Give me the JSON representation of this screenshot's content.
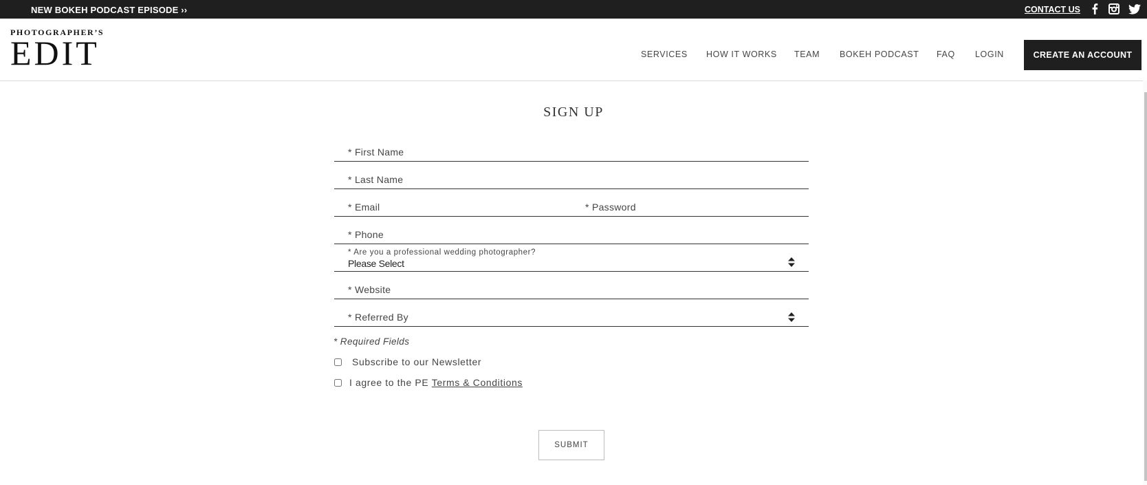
{
  "topbar": {
    "promo": "NEW BOKEH PODCAST EPISODE ››",
    "contact": "CONTACT US",
    "social": [
      {
        "name": "facebook-icon",
        "glyph": "f"
      },
      {
        "name": "instagram-icon",
        "glyph": "instagram"
      },
      {
        "name": "twitter-icon",
        "glyph": "twitter"
      }
    ]
  },
  "header": {
    "logo_top": "PHOTOGRAPHER’S",
    "logo_main": "EDIT",
    "nav": [
      "SERVICES",
      "HOW IT WORKS",
      "TEAM",
      "BOKEH PODCAST",
      "FAQ",
      "LOGIN"
    ],
    "cta": "CREATE AN ACCOUNT"
  },
  "form": {
    "title": "SIGN UP",
    "first_name": "* First Name",
    "last_name": "* Last Name",
    "email": "* Email",
    "password": "* Password",
    "phone": "* Phone",
    "professional_label": "* Are you a professional wedding photographer?",
    "professional_value": "Please Select",
    "website": "* Website",
    "referred_by": "* Referred By",
    "required_note": "* Required Fields",
    "newsletter": "Subscribe to our Newsletter",
    "agree_prefix": "I agree to the PE ",
    "agree_link": "Terms & Conditions",
    "submit": "SUBMIT"
  }
}
